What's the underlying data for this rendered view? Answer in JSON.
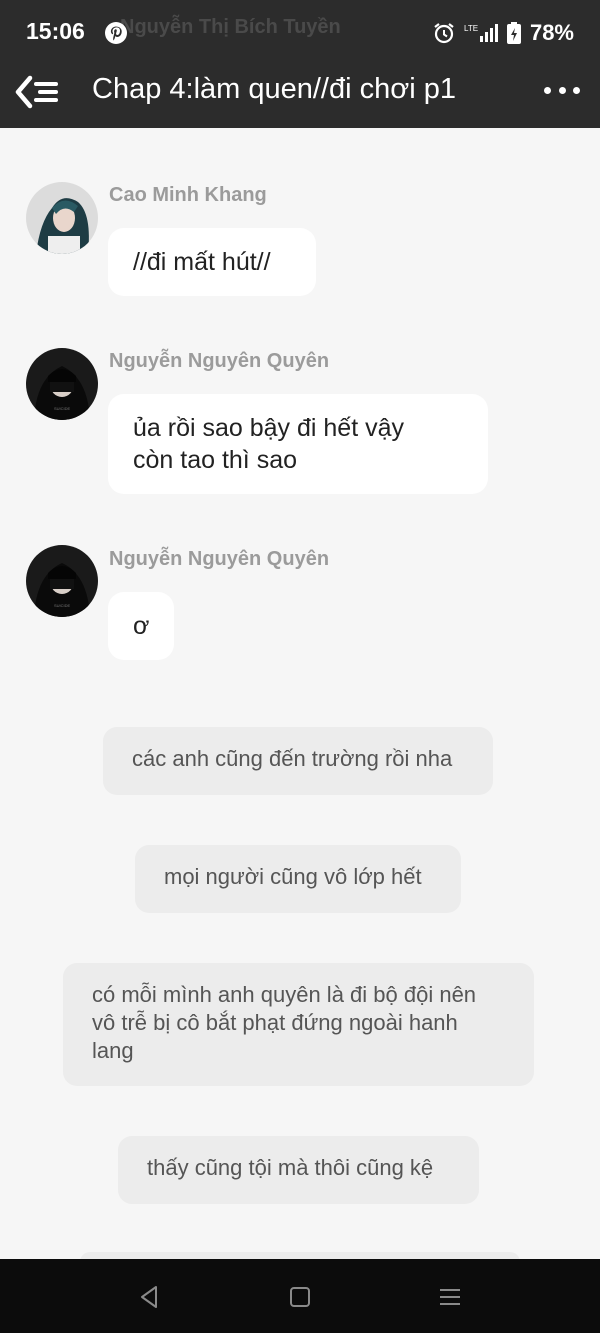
{
  "status_bar": {
    "time": "15:06",
    "battery": "78%",
    "network": "LTE",
    "ghost_text": "Nguyễn Thị Bích Tuyền"
  },
  "header": {
    "title": "Chap 4:làm quen//đi chơi p1"
  },
  "messages": [
    {
      "sender": "Cao Minh Khang",
      "text": "//đi mất hút//",
      "avatar": "avatar-girl-teal-hair"
    },
    {
      "sender": "Nguyễn Nguyên Quyên",
      "text_lines": [
        "ủa rồi sao bậy đi hết vậy",
        "còn tao thì sao"
      ],
      "avatar": "avatar-dark-hood"
    },
    {
      "sender": "Nguyễn Nguyên Quyên",
      "text": "ơ",
      "avatar": "avatar-dark-hood"
    }
  ],
  "narrations": [
    {
      "text": "các anh cũng đến trường rồi nha"
    },
    {
      "text": "mọi người cũng vô lớp hết"
    },
    {
      "text_lines": [
        "có mỗi mình anh quyên là đi bộ đội nên",
        "vô trễ bị cô bắt phạt đứng ngoài hanh",
        "lang"
      ]
    },
    {
      "text": "thấy cũng tội mà thôi cũng kệ"
    }
  ],
  "colors": {
    "header_bg": "#2c2c2c",
    "chat_bg": "#f6f6f6",
    "bubble_bg": "#ffffff",
    "narration_bg": "#ececec",
    "sender_color": "#9b9b9b",
    "nav_bg": "#0c0c0c"
  },
  "icons": [
    "pinterest-icon",
    "alarm-icon",
    "signal-icon",
    "battery-icon",
    "back-menu-icon",
    "more-icon",
    "nav-back-icon",
    "nav-home-icon",
    "nav-recent-icon"
  ]
}
